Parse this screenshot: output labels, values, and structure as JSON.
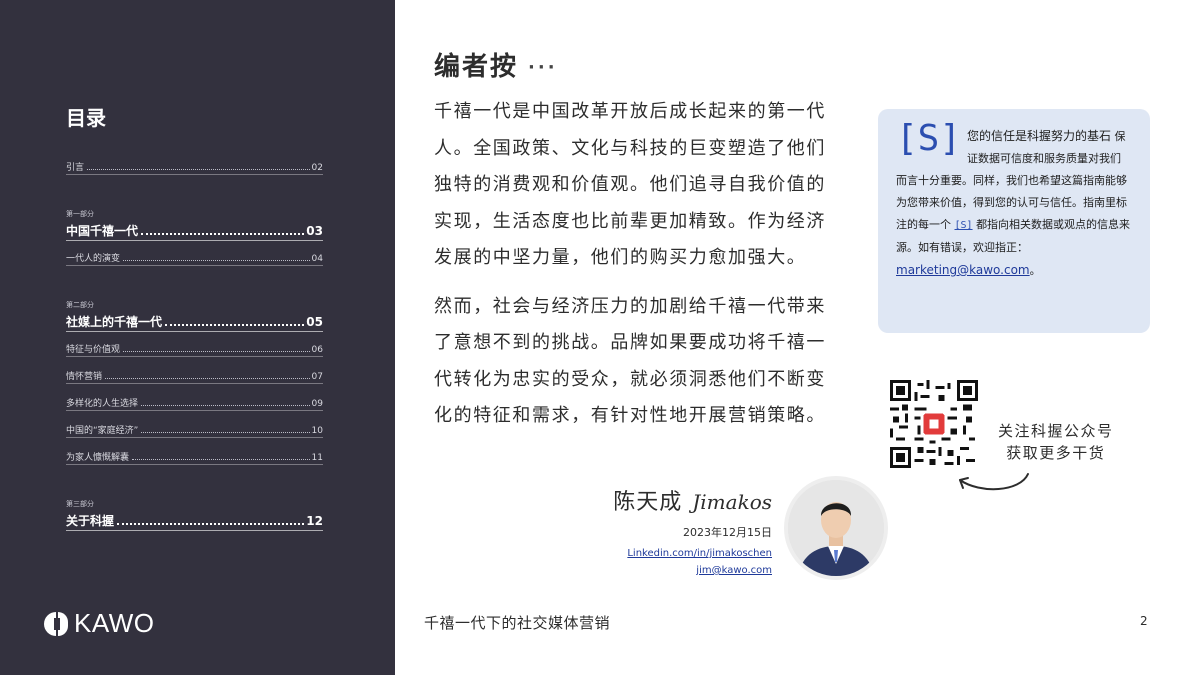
{
  "sidebar": {
    "toc_title": "目录",
    "intro": {
      "label": "引言",
      "page": "02"
    },
    "part1": {
      "section_label": "第一部分",
      "title": {
        "label": "中国千禧一代",
        "page": "03"
      },
      "items": [
        {
          "label": "一代人的演变",
          "page": "04"
        }
      ]
    },
    "part2": {
      "section_label": "第二部分",
      "title": {
        "label": "社媒上的千禧一代",
        "page": "05"
      },
      "items": [
        {
          "label": "特征与价值观",
          "page": "06"
        },
        {
          "label": "情怀营销",
          "page": "07"
        },
        {
          "label": "多样化的人生选择",
          "page": "09"
        },
        {
          "label": "中国的“家庭经济”",
          "page": "10"
        },
        {
          "label": "为家人慷慨解囊",
          "page": "11"
        }
      ]
    },
    "part3": {
      "section_label": "第三部分",
      "title": {
        "label": "关于科握",
        "page": "12"
      }
    },
    "logo_text": "KAWO"
  },
  "main": {
    "heading": "编者按",
    "heading_ellipsis": "···",
    "paragraphs": [
      "千禧一代是中国改革开放后成长起来的第一代人。全国政策、文化与科技的巨变塑造了他们独特的消费观和价值观。他们追寻自我价值的实现，生活态度也比前辈更加精致。作为经济发展的中坚力量，他们的购买力愈加强大。",
      "然而，社会与经济压力的加剧给千禧一代带来了意想不到的挑战。品牌如果要成功将千禧一代转化为忠实的受众，就必须洞悉他们不断变化的特征和需求，有针对性地开展营销策略。"
    ],
    "signature": {
      "name": "陈天成",
      "handwritten": "Jimakos",
      "date": "2023年12月15日",
      "linkedin": "Linkedin.com/in/jimakoschen",
      "email": "jim@kawo.com"
    }
  },
  "callout": {
    "badge": "[S]",
    "line1": "您的信任是科握努力的基石",
    "text_a": "保证数据可信度和服务质量对我们而言十分重要。同样，我们也希望这篇指南能够为您带来价值，得到您的认可与信任。指南里标注的每一个",
    "inline_badge": "[S]",
    "text_b": "都指向相关数据或观点的信息来源。如有错误，欢迎指正：",
    "email": "marketing@kawo.com",
    "period": "。"
  },
  "qr": {
    "follow_line1": "关注科握公众号",
    "follow_line2": "获取更多干货"
  },
  "footer": {
    "title": "千禧一代下的社交媒体营销",
    "page_number": "2"
  },
  "colors": {
    "sidebar_bg": "#33313e",
    "callout_bg": "#dfe7f4",
    "accent_blue": "#2b4eb0"
  }
}
